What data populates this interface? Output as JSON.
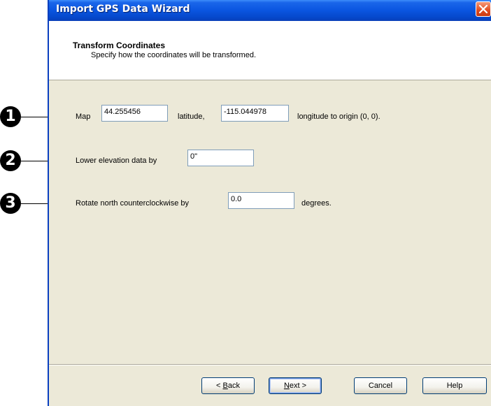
{
  "window": {
    "title": "Import GPS Data Wizard"
  },
  "header": {
    "title": "Transform Coordinates",
    "subtitle": "Specify how the coordinates will be transformed."
  },
  "callouts": [
    "1",
    "2",
    "3"
  ],
  "row1": {
    "map_label": "Map",
    "latitude_value": "44.255456",
    "latitude_label": "latitude,",
    "longitude_value": "-115.044978",
    "longitude_label": "longitude to origin (0, 0)."
  },
  "row2": {
    "label": "Lower elevation data by",
    "value": "0\""
  },
  "row3": {
    "label": "Rotate north counterclockwise by",
    "value": "0.0",
    "unit": "degrees."
  },
  "buttons": {
    "back": {
      "mnemonic": "B",
      "rest": "ack",
      "prefix": "< "
    },
    "next": {
      "mnemonic": "N",
      "rest": "ext >"
    },
    "cancel": "Cancel",
    "help": "Help"
  }
}
